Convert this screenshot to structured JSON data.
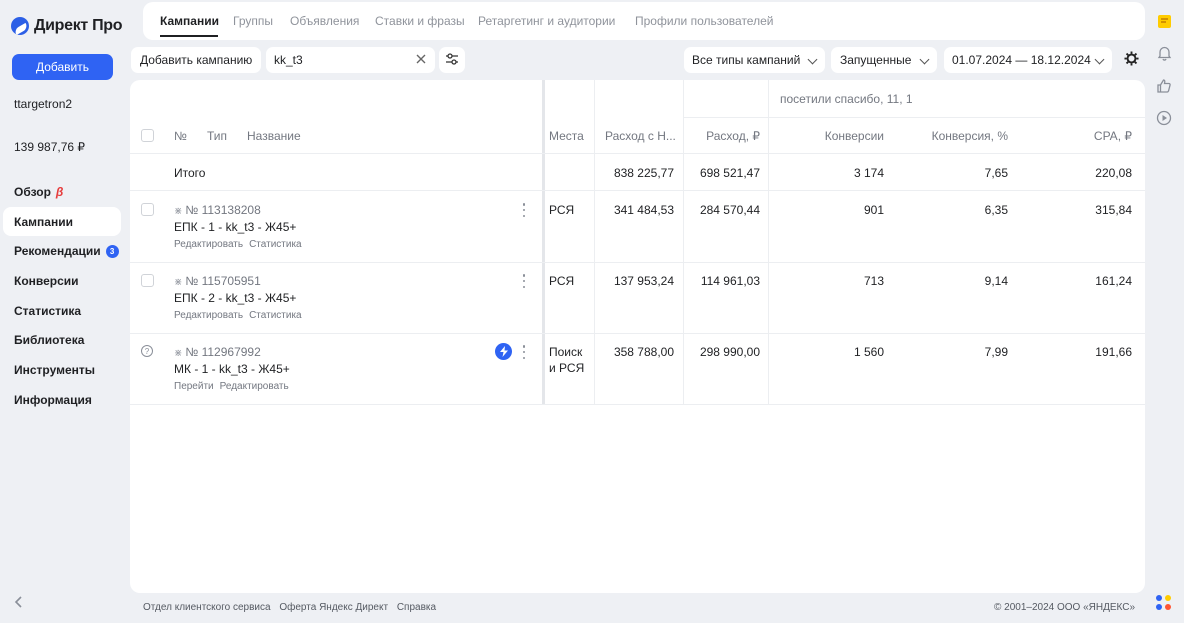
{
  "brand": {
    "title": "Директ Про"
  },
  "sidebar": {
    "add_label": "Добавить",
    "login": "ttargetron2",
    "balance": "139 987,76 ₽",
    "items": [
      {
        "label": "Обзор",
        "beta": "β"
      },
      {
        "label": "Кампании",
        "active": true
      },
      {
        "label": "Рекомендации",
        "badge": "3"
      },
      {
        "label": "Конверсии"
      },
      {
        "label": "Статистика"
      },
      {
        "label": "Библиотека"
      },
      {
        "label": "Инструменты"
      },
      {
        "label": "Информация"
      }
    ],
    "collapse_icon": "chevron-left-icon"
  },
  "tabs": [
    "Кампании",
    "Группы",
    "Объявления",
    "Ставки и фразы",
    "Ретаргетинг и аудитории",
    "Профили пользователей"
  ],
  "filters": {
    "add_campaign": "Добавить кампанию",
    "search_value": "kk_t3",
    "campaign_types": "Все типы кампаний",
    "status": "Запущенные",
    "date_range": "01.07.2024 — 18.12.2024"
  },
  "table": {
    "group_header": "посетили спасибо, 11, 1",
    "columns": {
      "num": "№",
      "type": "Тип",
      "name": "Название",
      "places": "Места",
      "spend_nds": "Расход с Н...",
      "spend": "Расход, ₽",
      "conversions": "Конверсии",
      "conv_rate": "Конверсия, %",
      "cpa": "CPA, ₽"
    },
    "total": {
      "label": "Итого",
      "spend_nds": "838 225,77",
      "spend": "698 521,47",
      "conversions": "3 174",
      "conv_rate": "7,65",
      "cpa": "220,08"
    },
    "rows": [
      {
        "num": "№ 113138208",
        "name": "ЕПК - 1 - kk_t3 - Ж45+",
        "link1": "Редактировать",
        "link2": "Статистика",
        "places": "РСЯ",
        "places2": "",
        "spend_nds": "341 484,53",
        "spend": "284 570,44",
        "conversions": "901",
        "conv_rate": "6,35",
        "cpa": "315,84"
      },
      {
        "num": "№ 115705951",
        "name": "ЕПК - 2 - kk_t3 - Ж45+",
        "link1": "Редактировать",
        "link2": "Статистика",
        "places": "РСЯ",
        "places2": "",
        "spend_nds": "137 953,24",
        "spend": "114 961,03",
        "conversions": "713",
        "conv_rate": "9,14",
        "cpa": "161,24"
      },
      {
        "num": "№ 112967992",
        "name": "МК - 1 - kk_t3 - Ж45+",
        "link1": "Перейти",
        "link2": "Редактировать",
        "places": "Поиск",
        "places2": "и РСЯ",
        "spend_nds": "358 788,00",
        "spend": "298 990,00",
        "conversions": "1 560",
        "conv_rate": "7,99",
        "cpa": "191,66"
      }
    ]
  },
  "footer": {
    "links": [
      "Отдел клиентского сервиса",
      "Оферта Яндекс Директ",
      "Справка"
    ],
    "copyright": "© 2001–2024 ООО «ЯНДЕКС»"
  },
  "colors": {
    "accent": "#2f63f3",
    "beta": "#e63c3c",
    "background": "#eef0f4"
  }
}
